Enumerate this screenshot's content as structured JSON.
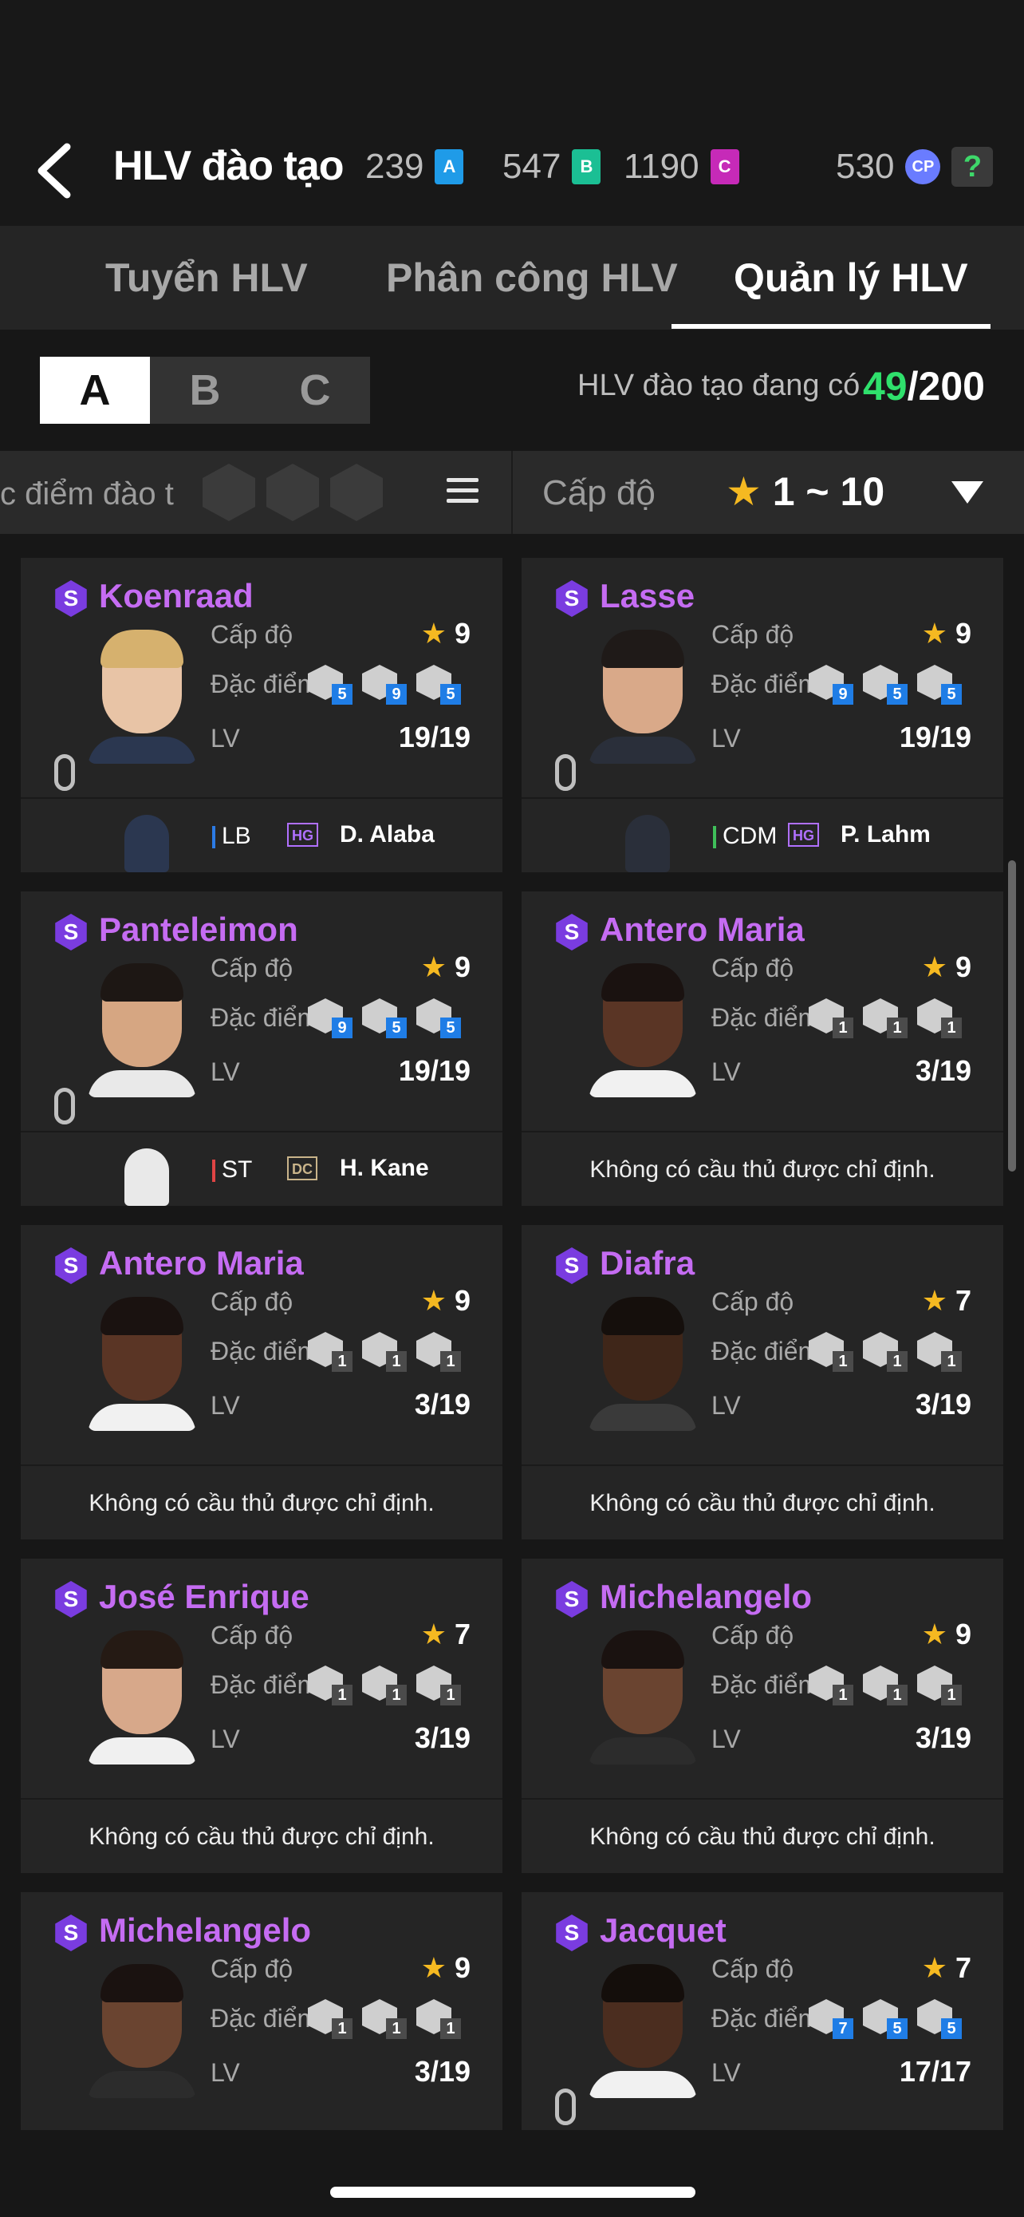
{
  "header": {
    "title": "HLV đào tạo",
    "currencies": [
      {
        "value": "239",
        "badge": "A",
        "color": "#1f9be8"
      },
      {
        "value": "547",
        "badge": "B",
        "color": "#1bbf94"
      },
      {
        "value": "1190",
        "badge": "C",
        "color": "#c62ab8"
      },
      {
        "value": "530",
        "badge": "CP",
        "color": "#6a7cff"
      }
    ],
    "help": "?"
  },
  "tabs": [
    "Tuyển HLV",
    "Phân công HLV",
    "Quản lý HLV"
  ],
  "active_tab": 2,
  "segments": [
    "A",
    "B",
    "C"
  ],
  "active_segment": 0,
  "coach_count": {
    "label": "HLV đào tạo đang có",
    "current": "49",
    "max": "/200"
  },
  "filter": {
    "trait_label": "c điểm đào t",
    "level_label": "Cấp độ",
    "level_range": "1 ~ 10"
  },
  "labels": {
    "level": "Cấp độ",
    "traits": "Đặc điểm",
    "lv": "LV",
    "badge": "S",
    "no_player": "Không có cầu thủ được chỉ định."
  },
  "cards": [
    {
      "name": "Koenraad",
      "level": "9",
      "lv": "19/19",
      "traits": [
        "5",
        "9",
        "5"
      ],
      "blue": true,
      "skin": "#e8c4a6",
      "hair": "#d6b16e",
      "shirt": "#2b3750",
      "assigned": {
        "pos": "LB",
        "pos_color": "#2c7be5",
        "tag": "HG",
        "tag_color": "#b070ff",
        "player": "D. Alaba"
      }
    },
    {
      "name": "Lasse",
      "level": "9",
      "lv": "19/19",
      "traits": [
        "9",
        "5",
        "5"
      ],
      "blue": true,
      "skin": "#d9a989",
      "hair": "#1f1a18",
      "shirt": "#2a2f3a",
      "assigned": {
        "pos": "CDM",
        "pos_color": "#3fbf5a",
        "tag": "HG",
        "tag_color": "#b070ff",
        "player": "P. Lahm"
      }
    },
    {
      "name": "Panteleimon",
      "level": "9",
      "lv": "19/19",
      "traits": [
        "9",
        "5",
        "5"
      ],
      "blue": true,
      "skin": "#d6a682",
      "hair": "#1d1714",
      "shirt": "#e9e9e9",
      "assigned": {
        "pos": "ST",
        "pos_color": "#e04444",
        "tag": "DC",
        "tag_color": "#c9b48a",
        "player": "H. Kane"
      }
    },
    {
      "name": "Antero Maria",
      "level": "9",
      "lv": "3/19",
      "traits": [
        "1",
        "1",
        "1"
      ],
      "blue": false,
      "skin": "#5a3525",
      "hair": "#1a1210",
      "shirt": "#f1f1f1",
      "assigned": null
    },
    {
      "name": "Antero Maria",
      "level": "9",
      "lv": "3/19",
      "traits": [
        "1",
        "1",
        "1"
      ],
      "blue": false,
      "skin": "#5a3525",
      "hair": "#1a1210",
      "shirt": "#f1f1f1",
      "assigned": null
    },
    {
      "name": "Diafra",
      "level": "7",
      "lv": "3/19",
      "traits": [
        "1",
        "1",
        "1"
      ],
      "blue": false,
      "skin": "#3f2619",
      "hair": "#150f0c",
      "shirt": "#3a3a3a",
      "assigned": null
    },
    {
      "name": "José Enrique",
      "level": "7",
      "lv": "3/19",
      "traits": [
        "1",
        "1",
        "1"
      ],
      "blue": false,
      "skin": "#d7a88a",
      "hair": "#251a14",
      "shirt": "#f0f0f0",
      "assigned": null
    },
    {
      "name": "Michelangelo",
      "level": "9",
      "lv": "3/19",
      "traits": [
        "1",
        "1",
        "1"
      ],
      "blue": false,
      "skin": "#6a4430",
      "hair": "#1a1210",
      "shirt": "#2c2c2c",
      "assigned": null
    },
    {
      "name": "Michelangelo",
      "level": "9",
      "lv": "3/19",
      "traits": [
        "1",
        "1",
        "1"
      ],
      "blue": false,
      "skin": "#6a4430",
      "hair": "#1a1210",
      "shirt": "#2c2c2c",
      "assigned": null
    },
    {
      "name": "Jacquet",
      "level": "7",
      "lv": "17/17",
      "traits": [
        "7",
        "5",
        "5"
      ],
      "blue": true,
      "skin": "#4b2d1f",
      "hair": "#140e0b",
      "shirt": "#f1f1f1",
      "assigned": null
    }
  ]
}
